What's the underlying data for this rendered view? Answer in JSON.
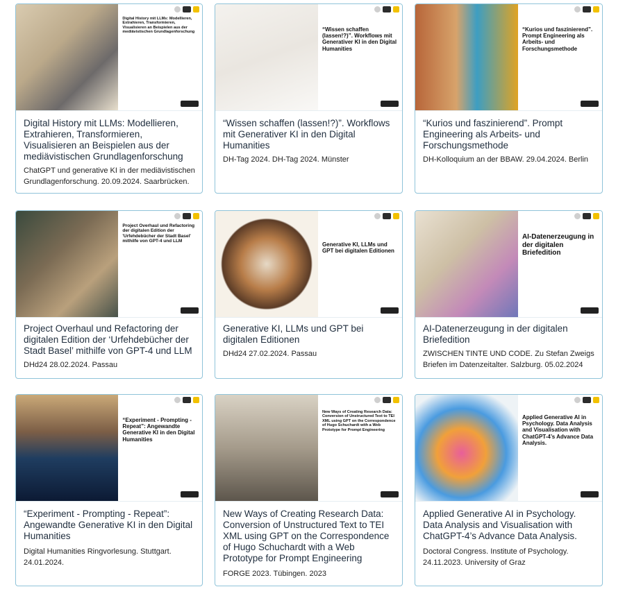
{
  "cards": [
    {
      "title": "Digital History mit LLMs: Modellieren, Extrahieren, Transformieren, Visualisieren an Beispielen aus der mediävistischen Grundlagenforschung",
      "desc": "ChatGPT und generative KI in der mediävistischen Grundlagenforschung. 20.09.2024. Saarbrücken.",
      "slide_title": "Digital History mit LLMs: Modellieren, Extrahieren, Transformieren, Visualisieren an Beispielen aus der mediävistischen Grundlagenforschung"
    },
    {
      "title": "“Wissen schaffen (lassen!?)”. Workflows mit Generativer KI in den Digital Humanities",
      "desc": "DH-Tag 2024. DH-Tag 2024. Münster",
      "slide_title": "“Wissen schaffen (lassen!?)”. Workflows mit Generativer KI in den Digital Humanities"
    },
    {
      "title": "“Kurios und faszinierend”. Prompt Engineering als Arbeits- und Forschungsmethode",
      "desc": "DH-Kolloquium an der BBAW. 29.04.2024. Berlin",
      "slide_title": "“Kurios und faszinierend”. Prompt Engineering als Arbeits- und Forschungsmethode"
    },
    {
      "title": "Project Overhaul und Refactoring der digitalen Edition der ‘Urfehdebücher der Stadt Basel’ mithilfe von GPT-4 und LLM",
      "desc": "DHd24 28.02.2024. Passau",
      "slide_title": "Project Overhaul und Refactoring der digitalen Edition der 'Urfehdebücher der Stadt Basel' mithilfe von GPT-4 und LLM"
    },
    {
      "title": "Generative KI, LLMs und GPT bei digitalen Editionen",
      "desc": "DHd24 27.02.2024. Passau",
      "slide_title": "Generative KI, LLMs und GPT bei digitalen Editionen"
    },
    {
      "title": "AI-Datenerzeugung in der digitalen Briefedition",
      "desc": "ZWISCHEN TINTE UND CODE. Zu Stefan Zweigs Briefen im Datenzeitalter. Salzburg. 05.02.2024",
      "slide_title": "AI-Datenerzeugung in der digitalen Briefedition"
    },
    {
      "title": "“Experiment - Prompting - Repeat”: Angewandte Generative KI in den Digital Humanities",
      "desc": "Digital Humanities Ringvorlesung. Stuttgart. 24.01.2024.",
      "slide_title": "“Experiment - Prompting - Repeat”: Angewandte Generative KI in den Digital Humanities"
    },
    {
      "title": "New Ways of Creating Research Data: Conversion of Unstructured Text to TEI XML using GPT on the Correspondence of Hugo Schuchardt with a Web Prototype for Prompt Engineering",
      "desc": "FORGE 2023. Tübingen. 2023",
      "slide_title": "New Ways of Creating Research Data: Conversion of Unstructured Text to TEI XML using GPT on the Correspondence of Hugo Schuchardt with a Web Prototype for Prompt Engineering"
    },
    {
      "title": "Applied Generative AI in Psychology. Data Analysis and Visualisation with ChatGPT-4’s Advance Data Analysis.",
      "desc": "Doctoral Congress. Institute of Psychology. 24.11.2023. University of Graz",
      "slide_title": "Applied Generative AI in Psychology. Data Analysis and Visualisation with ChatGPT-4’s Advance Data Analysis."
    }
  ]
}
